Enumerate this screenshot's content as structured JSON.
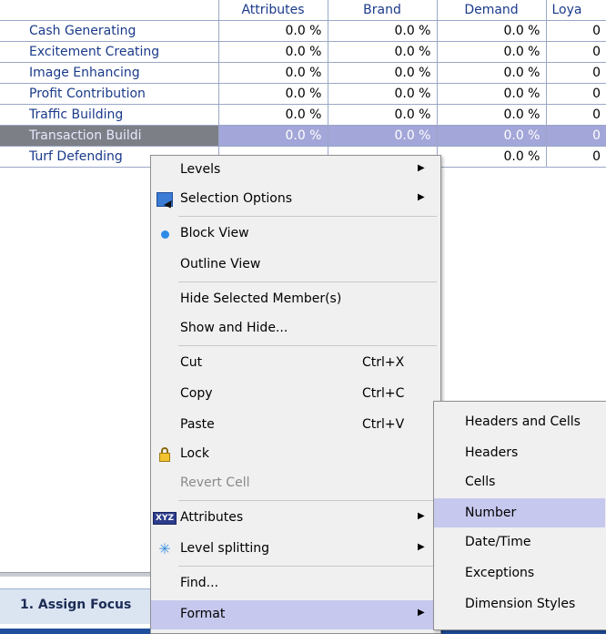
{
  "grid": {
    "columns": [
      "Attributes",
      "Brand",
      "Demand",
      "Loya"
    ],
    "rows": [
      {
        "name": "Cash Generating",
        "values": [
          "0.0 %",
          "0.0 %",
          "0.0 %",
          "0"
        ]
      },
      {
        "name": "Excitement Creating",
        "values": [
          "0.0 %",
          "0.0 %",
          "0.0 %",
          "0"
        ]
      },
      {
        "name": "Image Enhancing",
        "values": [
          "0.0 %",
          "0.0 %",
          "0.0 %",
          "0"
        ]
      },
      {
        "name": "Profit Contribution",
        "values": [
          "0.0 %",
          "0.0 %",
          "0.0 %",
          "0"
        ]
      },
      {
        "name": "Traffic Building",
        "values": [
          "0.0 %",
          "0.0 %",
          "0.0 %",
          "0"
        ]
      },
      {
        "name": "Transaction Buildi",
        "values": [
          "0.0 %",
          "0.0 %",
          "0.0 %",
          "0"
        ]
      },
      {
        "name": "Turf Defending",
        "values": [
          "",
          "",
          "0.0 %",
          "0"
        ]
      }
    ]
  },
  "bottom": {
    "tab_label": "1. Assign Focus"
  },
  "context_menu": {
    "items": [
      {
        "label": "Levels",
        "shortcut": "",
        "icon": ""
      },
      {
        "label": "Selection Options",
        "shortcut": "",
        "icon": "selection-options-icon"
      },
      {
        "label": "Block View",
        "shortcut": "",
        "icon": "radio-dot-icon"
      },
      {
        "label": "Outline View",
        "shortcut": "",
        "icon": ""
      },
      {
        "label": "Hide Selected Member(s)",
        "shortcut": "",
        "icon": ""
      },
      {
        "label": "Show and Hide...",
        "shortcut": "",
        "icon": ""
      },
      {
        "label": "Cut",
        "shortcut": "Ctrl+X",
        "icon": ""
      },
      {
        "label": "Copy",
        "shortcut": "Ctrl+C",
        "icon": ""
      },
      {
        "label": "Paste",
        "shortcut": "Ctrl+V",
        "icon": ""
      },
      {
        "label": "Lock",
        "shortcut": "",
        "icon": "lock-icon"
      },
      {
        "label": "Revert Cell",
        "shortcut": "",
        "icon": ""
      },
      {
        "label": "Attributes",
        "shortcut": "",
        "icon": "xyz-icon"
      },
      {
        "label": "Level splitting",
        "shortcut": "",
        "icon": "level-splitting-icon"
      },
      {
        "label": "Find...",
        "shortcut": "",
        "icon": ""
      },
      {
        "label": "Format",
        "shortcut": "",
        "icon": ""
      }
    ]
  },
  "submenu": {
    "items": [
      {
        "label": "Headers and Cells"
      },
      {
        "label": "Headers"
      },
      {
        "label": "Cells"
      },
      {
        "label": "Number"
      },
      {
        "label": "Date/Time"
      },
      {
        "label": "Exceptions"
      },
      {
        "label": "Dimension Styles"
      }
    ]
  },
  "colors": {
    "header_text": "#1a3a8a",
    "selected_row": "#a3a6d8",
    "menu_highlight": "#c6c8ee",
    "bottom_strip": "#1f4f9c"
  }
}
